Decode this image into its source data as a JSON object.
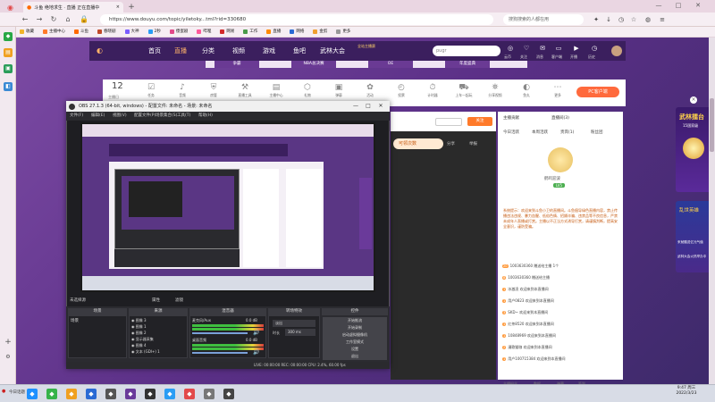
{
  "browser": {
    "tab_title": "斗鱼 绝地求生 · 直播 正在直播中",
    "new_tab_label": "+",
    "url": "https://www.douyu.com/topic/yiletoky...tml?rid=330680",
    "search_placeholder": "搜狗搜索的人都在用",
    "bookmarks": [
      {
        "label": "收藏",
        "color": "#f0b429"
      },
      {
        "label": "主播中心",
        "color": "#ff7a2a"
      },
      {
        "label": "斗鱼",
        "color": "#ff6a00"
      },
      {
        "label": "春晓剧",
        "color": "#c04a2a"
      },
      {
        "label": "大神",
        "color": "#7a5cff"
      },
      {
        "label": "2秒",
        "color": "#2a9df4"
      },
      {
        "label": "傻蛋剧",
        "color": "#e24a8a"
      },
      {
        "label": "哔哩",
        "color": "#ff5a9a"
      },
      {
        "label": "网易",
        "color": "#d22a2a"
      },
      {
        "label": "工作",
        "color": "#4a9a4a"
      },
      {
        "label": "直播",
        "color": "#ff8a00"
      },
      {
        "label": "网络",
        "color": "#2a6ad4"
      },
      {
        "label": "金剪",
        "color": "#f0a030"
      },
      {
        "label": "更多",
        "color": "#999999"
      }
    ]
  },
  "site": {
    "nav": [
      "首页",
      "直播",
      "分类",
      "视频",
      "游戏",
      "鱼吧",
      "武林大会"
    ],
    "nav_active": "直播",
    "search_placeholder": "pugr",
    "user_icons": [
      "云币",
      "关注",
      "消息",
      "客户端",
      "开播",
      "历史"
    ],
    "subnav": [
      "争霸",
      "NBA总决赛",
      "OE",
      "年度盛典"
    ],
    "day_count": "12",
    "day_label": "主播日",
    "toolbar_items": [
      "任务",
      "音频",
      "房管",
      "直播工具",
      "主播中心",
      "礼物",
      "弹幕",
      "活动",
      "投票",
      "计时器",
      "上车一起玩",
      "分享视频",
      "鱼丸",
      "更多"
    ],
    "pc_button": "PC客户端"
  },
  "stream": {
    "follow": "关注",
    "rank_badge": "可领次数",
    "share": "分享",
    "report": "举报"
  },
  "chat": {
    "tabs": [
      "今日活跃",
      "本周活跃",
      "贵宾(1)",
      "粉丝团"
    ],
    "header": [
      "主播贡献",
      "直播间(3)"
    ],
    "streamer_name": "鹤鸣迎波",
    "streamer_level": "LV5",
    "system_notice": "系统提示：欢迎来到斗鱼小卫的直播间。斗鱼倡导绿色直播内容，禁止传播违法违规、暴力血腥、低俗色情、招嫖诈骗、违禁品等不良信息，严禁未成年人直播或打赏。主播以不正当方式诱导打赏，请谨慎判断，提高安全意识，谨防受骗。",
    "lines": [
      {
        "level": "20",
        "text": "1003630360 赠送给主播 1个"
      },
      {
        "level": "8",
        "text": "1003630360 赠送给主播"
      },
      {
        "level": "1",
        "text": "冰激凌 欢迎来到本直播间"
      },
      {
        "level": "1",
        "text": "用户0823 欢迎来到本直播间"
      },
      {
        "level": "3",
        "text": "SKD~ 欢迎来到本直播间"
      },
      {
        "level": "1",
        "text": "红茶8520 欢迎来到本直播间"
      },
      {
        "level": "1",
        "text": "10848969 欢迎来到本直播间"
      },
      {
        "level": "2",
        "text": "漫歌猫咖 欢迎来到本直播间"
      },
      {
        "level": "1",
        "text": "用户100715384 欢迎来到本直播间"
      }
    ],
    "footer": [
      "主播粉丝",
      "数据",
      "弹幕",
      "签到"
    ]
  },
  "ads": {
    "top_title": "武林擂台",
    "top_sub": "15国家级",
    "bottom_title": "乱世英雄",
    "bottom_text": "来就赠送亿元气值",
    "bottom_sub": "武林大会火热举办中"
  },
  "obs": {
    "title": "OBS 27.1.3 (64-bit, windows) - 配置文件: 未命名 - 场景: 未命名",
    "menu": [
      "文件(F)",
      "编辑(E)",
      "视图(V)",
      "配置文件(P)",
      "场景集合(S)",
      "工具(T)",
      "帮助(H)"
    ],
    "source_info": "未选择源",
    "properties_label": "属性",
    "filters_label": "滤镜",
    "docks": [
      "场景",
      "来源",
      "混音器",
      "转场特效",
      "控件"
    ],
    "scenes": [
      "场景"
    ],
    "sources": [
      "图像 3",
      "图像 1",
      "图像 2",
      "显示器采集",
      "图像 4",
      "文本 (GDI+) 1"
    ],
    "mixer": [
      {
        "label": "桌面音频",
        "level": "0.0 dB"
      },
      {
        "label": "麦克风/Aux",
        "level": "0.0 dB"
      }
    ],
    "transition": "淡出",
    "duration_label": "时长",
    "duration_value": "300 ms",
    "controls": [
      "开始推流",
      "开始录制",
      "启动虚拟摄像机",
      "工作室模式",
      "设置",
      "退出"
    ],
    "status": "LIVE: 00:00:00   REC: 00:00:00   CPU: 2.4%, 60.00 fps"
  },
  "taskbar": {
    "search_label": "今日话题",
    "time": "9:47 周三",
    "date": "2022/3/23"
  }
}
